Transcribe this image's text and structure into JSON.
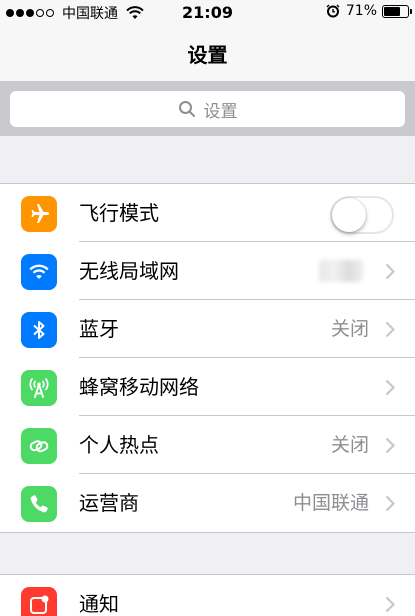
{
  "status_bar": {
    "carrier": "中国联通",
    "time": "21:09",
    "battery": "71%",
    "battery_level": 0.71
  },
  "nav": {
    "title": "设置"
  },
  "search": {
    "placeholder": "设置"
  },
  "settings": [
    {
      "label": "飞行模式",
      "icon": "airplane-icon",
      "icon_color": "#ff9500",
      "toggle_on": false
    },
    {
      "label": "无线局域网",
      "icon": "wifi-icon",
      "icon_color": "#007aff"
    },
    {
      "label": "蓝牙",
      "icon": "bluetooth-icon",
      "icon_color": "#007aff",
      "value": "关闭"
    },
    {
      "label": "蜂窝移动网络",
      "icon": "antenna-icon",
      "icon_color": "#4cd964"
    },
    {
      "label": "个人热点",
      "icon": "hotspot-icon",
      "icon_color": "#4cd964",
      "value": "关闭"
    },
    {
      "label": "运营商",
      "icon": "phone-icon",
      "icon_color": "#4cd964",
      "value": "中国联通"
    }
  ],
  "settings2": [
    {
      "label": "通知",
      "icon": "notification-icon",
      "icon_color": "#ff3b30"
    }
  ]
}
